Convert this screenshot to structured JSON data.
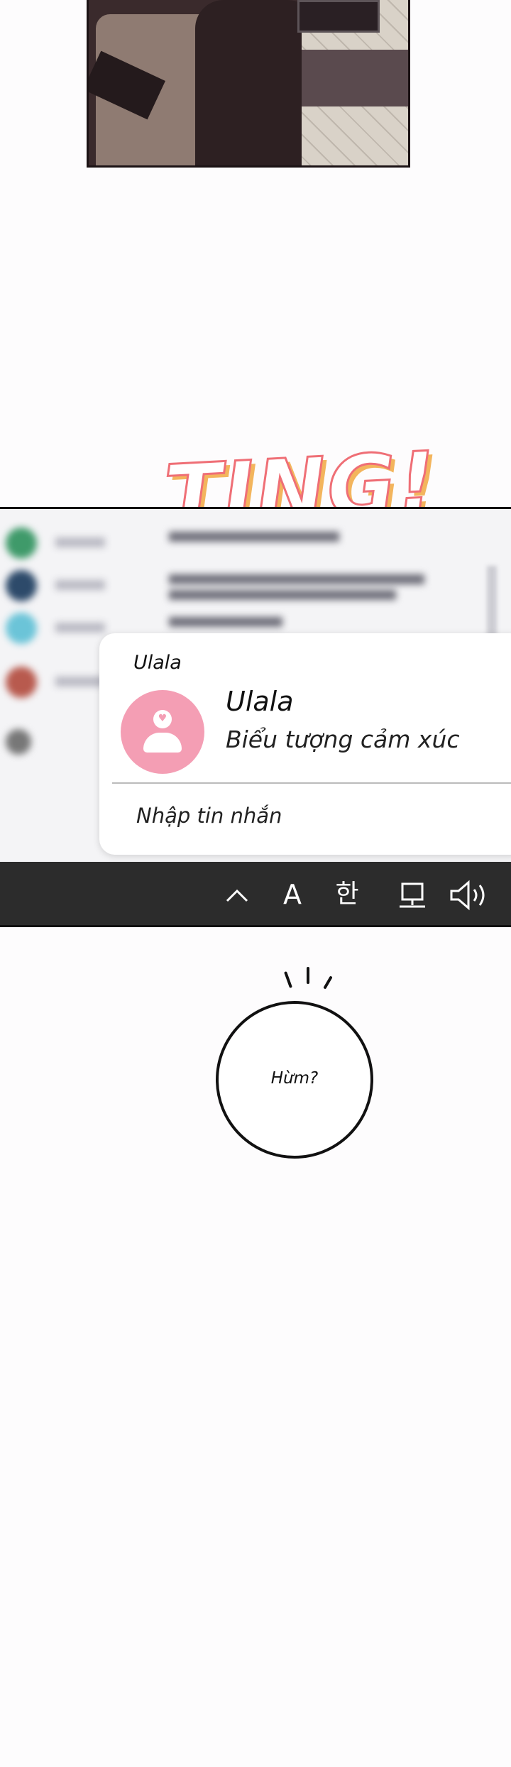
{
  "sfx": {
    "text": "TING!"
  },
  "notification": {
    "app_name": "Ulala",
    "sender": "Ulala",
    "message_preview": "Biểu tượng cảm xúc",
    "reply_placeholder": "Nhập tin nhắn"
  },
  "taskbar": {
    "input_mode_latin": "A",
    "input_mode_korean": "한",
    "icons": [
      "chevron-up-icon",
      "network-icon",
      "volume-icon"
    ]
  },
  "speech_bubble": {
    "text": "Hừm?"
  },
  "colors": {
    "sfx_outline": "#ef6f76",
    "sfx_shadow": "#f3b55d",
    "avatar_pink": "#f49eb4",
    "taskbar": "#2c2c2c"
  }
}
